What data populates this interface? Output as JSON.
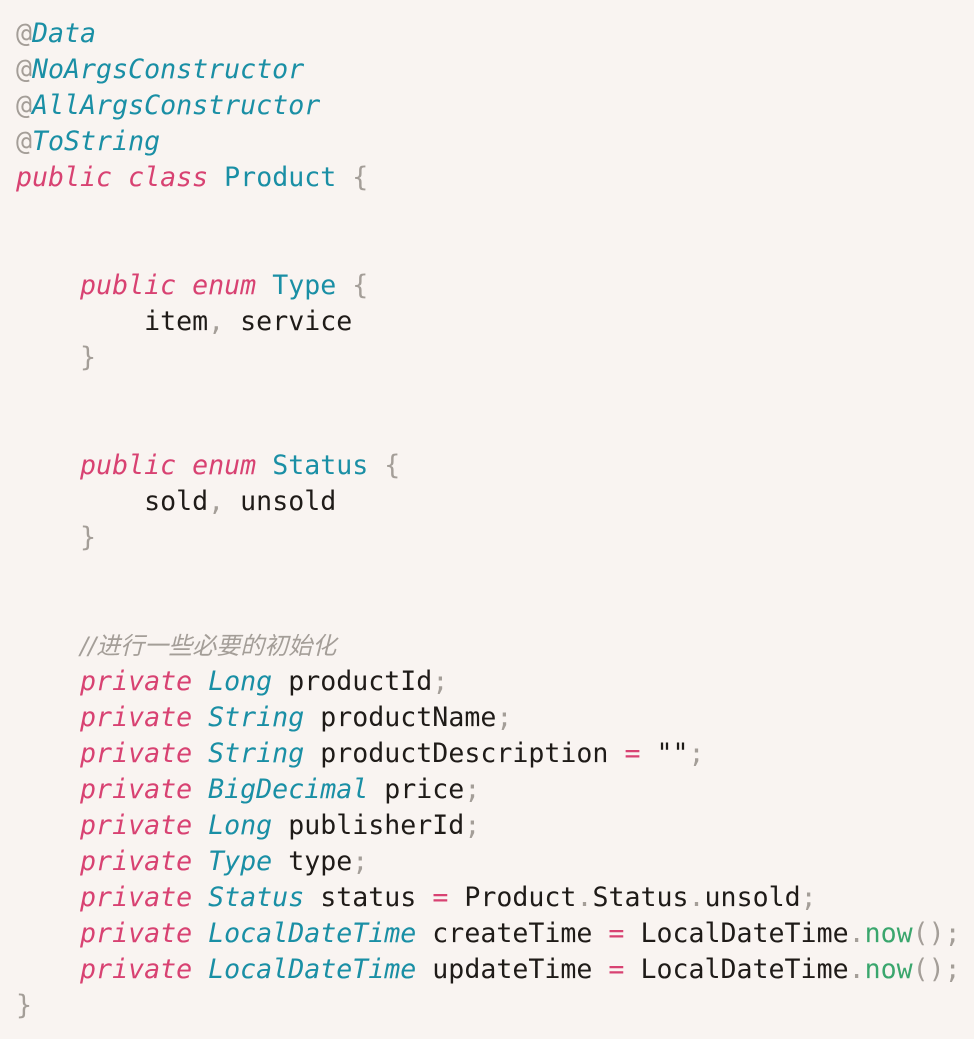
{
  "lines": [
    [
      {
        "t": "@",
        "c": "ann-at"
      },
      {
        "t": "Data",
        "c": "ann"
      }
    ],
    [
      {
        "t": "@",
        "c": "ann-at"
      },
      {
        "t": "NoArgsConstructor",
        "c": "ann"
      }
    ],
    [
      {
        "t": "@",
        "c": "ann-at"
      },
      {
        "t": "AllArgsConstructor",
        "c": "ann"
      }
    ],
    [
      {
        "t": "@",
        "c": "ann-at"
      },
      {
        "t": "ToString",
        "c": "ann"
      }
    ],
    [
      {
        "t": "public",
        "c": "kw"
      },
      {
        "t": " "
      },
      {
        "t": "class",
        "c": "kw"
      },
      {
        "t": " "
      },
      {
        "t": "Product",
        "c": "type"
      },
      {
        "t": " "
      },
      {
        "t": "{",
        "c": "punct"
      }
    ],
    [],
    [],
    [
      {
        "t": "    "
      },
      {
        "t": "public",
        "c": "kw"
      },
      {
        "t": " "
      },
      {
        "t": "enum",
        "c": "kw"
      },
      {
        "t": " "
      },
      {
        "t": "Type",
        "c": "type"
      },
      {
        "t": " "
      },
      {
        "t": "{",
        "c": "punct"
      }
    ],
    [
      {
        "t": "        "
      },
      {
        "t": "item",
        "c": "id"
      },
      {
        "t": ",",
        "c": "punct"
      },
      {
        "t": " "
      },
      {
        "t": "service",
        "c": "id"
      }
    ],
    [
      {
        "t": "    "
      },
      {
        "t": "}",
        "c": "punct"
      }
    ],
    [],
    [],
    [
      {
        "t": "    "
      },
      {
        "t": "public",
        "c": "kw"
      },
      {
        "t": " "
      },
      {
        "t": "enum",
        "c": "kw"
      },
      {
        "t": " "
      },
      {
        "t": "Status",
        "c": "type"
      },
      {
        "t": " "
      },
      {
        "t": "{",
        "c": "punct"
      }
    ],
    [
      {
        "t": "        "
      },
      {
        "t": "sold",
        "c": "id"
      },
      {
        "t": ",",
        "c": "punct"
      },
      {
        "t": " "
      },
      {
        "t": "unsold",
        "c": "id"
      }
    ],
    [
      {
        "t": "    "
      },
      {
        "t": "}",
        "c": "punct"
      }
    ],
    [],
    [],
    [
      {
        "t": "    "
      },
      {
        "t": "//进行一些必要的初始化",
        "c": "comment"
      }
    ],
    [
      {
        "t": "    "
      },
      {
        "t": "private",
        "c": "kw"
      },
      {
        "t": " "
      },
      {
        "t": "Long",
        "c": "type-i"
      },
      {
        "t": " "
      },
      {
        "t": "productId",
        "c": "id"
      },
      {
        "t": ";",
        "c": "punct"
      }
    ],
    [
      {
        "t": "    "
      },
      {
        "t": "private",
        "c": "kw"
      },
      {
        "t": " "
      },
      {
        "t": "String",
        "c": "type-i"
      },
      {
        "t": " "
      },
      {
        "t": "productName",
        "c": "id"
      },
      {
        "t": ";",
        "c": "punct"
      }
    ],
    [
      {
        "t": "    "
      },
      {
        "t": "private",
        "c": "kw"
      },
      {
        "t": " "
      },
      {
        "t": "String",
        "c": "type-i"
      },
      {
        "t": " "
      },
      {
        "t": "productDescription",
        "c": "id"
      },
      {
        "t": " "
      },
      {
        "t": "=",
        "c": "op"
      },
      {
        "t": " "
      },
      {
        "t": "\"\"",
        "c": "str"
      },
      {
        "t": ";",
        "c": "punct"
      }
    ],
    [
      {
        "t": "    "
      },
      {
        "t": "private",
        "c": "kw"
      },
      {
        "t": " "
      },
      {
        "t": "BigDecimal",
        "c": "type-i"
      },
      {
        "t": " "
      },
      {
        "t": "price",
        "c": "id"
      },
      {
        "t": ";",
        "c": "punct"
      }
    ],
    [
      {
        "t": "    "
      },
      {
        "t": "private",
        "c": "kw"
      },
      {
        "t": " "
      },
      {
        "t": "Long",
        "c": "type-i"
      },
      {
        "t": " "
      },
      {
        "t": "publisherId",
        "c": "id"
      },
      {
        "t": ";",
        "c": "punct"
      }
    ],
    [
      {
        "t": "    "
      },
      {
        "t": "private",
        "c": "kw"
      },
      {
        "t": " "
      },
      {
        "t": "Type",
        "c": "type-i"
      },
      {
        "t": " "
      },
      {
        "t": "type",
        "c": "id"
      },
      {
        "t": ";",
        "c": "punct"
      }
    ],
    [
      {
        "t": "    "
      },
      {
        "t": "private",
        "c": "kw"
      },
      {
        "t": " "
      },
      {
        "t": "Status",
        "c": "type-i"
      },
      {
        "t": " "
      },
      {
        "t": "status",
        "c": "id"
      },
      {
        "t": " "
      },
      {
        "t": "=",
        "c": "op"
      },
      {
        "t": " "
      },
      {
        "t": "Product",
        "c": "id"
      },
      {
        "t": ".",
        "c": "punct"
      },
      {
        "t": "Status",
        "c": "id"
      },
      {
        "t": ".",
        "c": "punct"
      },
      {
        "t": "unsold",
        "c": "id"
      },
      {
        "t": ";",
        "c": "punct"
      }
    ],
    [
      {
        "t": "    "
      },
      {
        "t": "private",
        "c": "kw"
      },
      {
        "t": " "
      },
      {
        "t": "LocalDateTime",
        "c": "type-i"
      },
      {
        "t": " "
      },
      {
        "t": "createTime",
        "c": "id"
      },
      {
        "t": " "
      },
      {
        "t": "=",
        "c": "op"
      },
      {
        "t": " "
      },
      {
        "t": "LocalDateTime",
        "c": "id"
      },
      {
        "t": ".",
        "c": "punct"
      },
      {
        "t": "now",
        "c": "method"
      },
      {
        "t": "();",
        "c": "punct"
      }
    ],
    [
      {
        "t": "    "
      },
      {
        "t": "private",
        "c": "kw"
      },
      {
        "t": " "
      },
      {
        "t": "LocalDateTime",
        "c": "type-i"
      },
      {
        "t": " "
      },
      {
        "t": "updateTime",
        "c": "id"
      },
      {
        "t": " "
      },
      {
        "t": "=",
        "c": "op"
      },
      {
        "t": " "
      },
      {
        "t": "LocalDateTime",
        "c": "id"
      },
      {
        "t": ".",
        "c": "punct"
      },
      {
        "t": "now",
        "c": "method"
      },
      {
        "t": "();",
        "c": "punct"
      }
    ],
    [
      {
        "t": "}",
        "c": "punct"
      }
    ]
  ],
  "colors": {
    "background": "#f9f4f1",
    "keyword": "#d84272",
    "type": "#1a8fa5",
    "punctuation": "#a49e98",
    "identifier": "#1f1b18",
    "method": "#3aa66d",
    "comment": "#a49e98"
  }
}
